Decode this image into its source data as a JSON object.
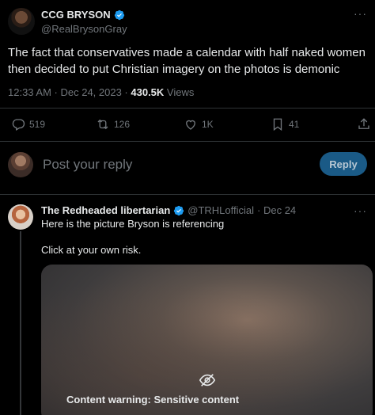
{
  "main_tweet": {
    "author_name": "CCG BRYSON",
    "author_handle": "@RealBrysonGray",
    "more": "···",
    "text": "The fact that conservatives made a calendar with half naked women then decided to put Christian imagery on the photos is demonic",
    "timestamp": "12:33 AM · Dec 24, 2023 · ",
    "views_count": "430.5K",
    "views_label": " Views"
  },
  "actions": {
    "replies": "519",
    "reposts": "126",
    "likes": "1K",
    "bookmarks": "41"
  },
  "reply_box": {
    "placeholder": "Post your reply",
    "button_label": "Reply"
  },
  "reply_tweet": {
    "author_name": "The Redheaded libertarian",
    "author_handle": "@TRHLofficial",
    "date": "· Dec 24",
    "more": "···",
    "text_line1": "Here is the picture Bryson is referencing",
    "text_line2": "Click at your own risk.",
    "media_warning": "Content warning: Sensitive content"
  },
  "colors": {
    "accent": "#1d9bf0",
    "muted": "#71767b",
    "divider": "#2f3336"
  },
  "icons": [
    "verified-badge-icon",
    "reply-icon",
    "repost-icon",
    "like-icon",
    "bookmark-icon",
    "share-icon",
    "eye-slash-icon"
  ]
}
